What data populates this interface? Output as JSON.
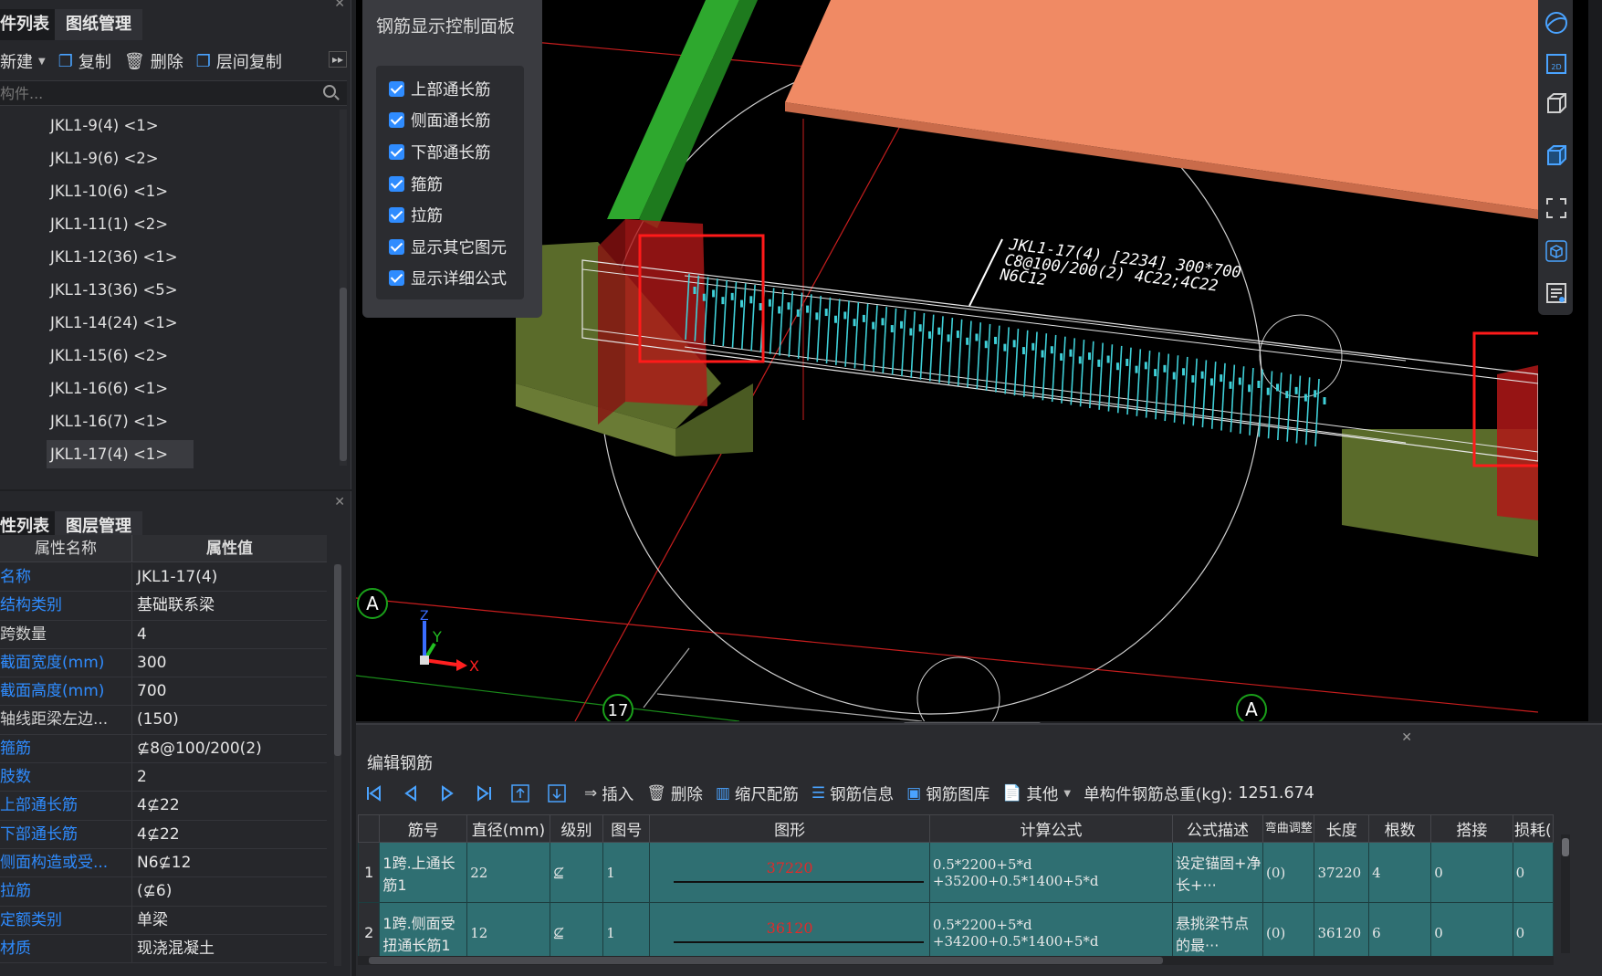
{
  "top_panel": {
    "tabs": [
      "件列表",
      "图纸管理"
    ],
    "toolbar": {
      "new": "新建",
      "copy": "复制",
      "delete": "删除",
      "floor_copy": "层间复制"
    },
    "search_placeholder": "构件...",
    "components": [
      "JKL1-9(4) <1>",
      "JKL1-9(6) <2>",
      "JKL1-10(6) <1>",
      "JKL1-11(1) <2>",
      "JKL1-12(36) <1>",
      "JKL1-13(36) <5>",
      "JKL1-14(24) <1>",
      "JKL1-15(6) <2>",
      "JKL1-16(6) <1>",
      "JKL1-16(7) <1>",
      "JKL1-17(4) <1>"
    ],
    "selected_component": "JKL1-17(4) <1>"
  },
  "bottom_panel": {
    "tabs": [
      "性列表",
      "图层管理"
    ],
    "header": {
      "name": "属性名称",
      "value": "属性值"
    },
    "properties": [
      {
        "name": "名称",
        "value": "JKL1-17(4)",
        "link": true
      },
      {
        "name": "结构类别",
        "value": "基础联系梁",
        "link": true
      },
      {
        "name": "跨数量",
        "value": "4",
        "link": false
      },
      {
        "name": "截面宽度(mm)",
        "value": "300",
        "link": true
      },
      {
        "name": "截面高度(mm)",
        "value": "700",
        "link": true
      },
      {
        "name": "轴线距梁左边...",
        "value": "(150)",
        "link": false
      },
      {
        "name": "箍筋",
        "value": "⊈8@100/200(2)",
        "link": true
      },
      {
        "name": "肢数",
        "value": "2",
        "link": true
      },
      {
        "name": "上部通长筋",
        "value": "4⊈22",
        "link": true
      },
      {
        "name": "下部通长筋",
        "value": "4⊈22",
        "link": true
      },
      {
        "name": "侧面构造或受...",
        "value": "N6⊈12",
        "link": true
      },
      {
        "name": "拉筋",
        "value": "(⊈6)",
        "link": true
      },
      {
        "name": "定额类别",
        "value": "单梁",
        "link": true
      },
      {
        "name": "材质",
        "value": "现浇混凝土",
        "link": true
      }
    ]
  },
  "rebar_display_panel": {
    "title": "钢筋显示控制面板",
    "options": [
      "上部通长筋",
      "侧面通长筋",
      "下部通长筋",
      "箍筋",
      "拉筋",
      "显示其它图元",
      "显示详细公式"
    ]
  },
  "viewport": {
    "beam_label_line1": "JKL1-17(4) [2234] 300*700",
    "beam_label_line2": "C8@100/200(2) 4C22;4C22",
    "beam_label_line3": "N6C12",
    "axis_a_left": "A",
    "axis_a_right": "A",
    "axis_17": "17",
    "axis_x": "X",
    "axis_y": "Y",
    "axis_z": "Z",
    "colors": {
      "slab": "#f08a64",
      "column_green": "#2ea82e",
      "footing": "#5a6b2a",
      "highlight": "#ff1a1a",
      "stirrup": "#3fd0d8"
    }
  },
  "edit_panel": {
    "title": "编辑钢筋",
    "toolbar": {
      "insert": "插入",
      "delete": "删除",
      "scale_rebar": "缩尺配筋",
      "rebar_info": "钢筋信息",
      "rebar_library": "钢筋图库",
      "other": "其他",
      "total_weight_label": "单构件钢筋总重(kg):",
      "total_weight": "1251.674"
    },
    "columns": [
      "筋号",
      "直径(mm)",
      "级别",
      "图号",
      "图形",
      "计算公式",
      "公式描述",
      "弯曲调整",
      "长度",
      "根数",
      "搭接",
      "损耗("
    ],
    "rows": [
      {
        "num": "1",
        "bar": "1跨.上通长筋1",
        "dia": "22",
        "grade": "⊈",
        "fig": "1",
        "shape": "37220",
        "formula1": "0.5*2200+5*d",
        "formula2": "+35200+0.5*1400+5*d",
        "desc": "设定锚固+净长+···",
        "bend": "(0)",
        "length": "37220",
        "count": "4",
        "lap": "0",
        "loss": "0"
      },
      {
        "num": "2",
        "bar": "1跨.侧面受扭通长筋1",
        "dia": "12",
        "grade": "⊈",
        "fig": "1",
        "shape": "36120",
        "formula1": "0.5*2200+5*d",
        "formula2": "+34200+0.5*1400+5*d",
        "desc": "悬挑梁节点的最···",
        "bend": "(0)",
        "length": "36120",
        "count": "6",
        "lap": "0",
        "loss": "0"
      }
    ]
  }
}
